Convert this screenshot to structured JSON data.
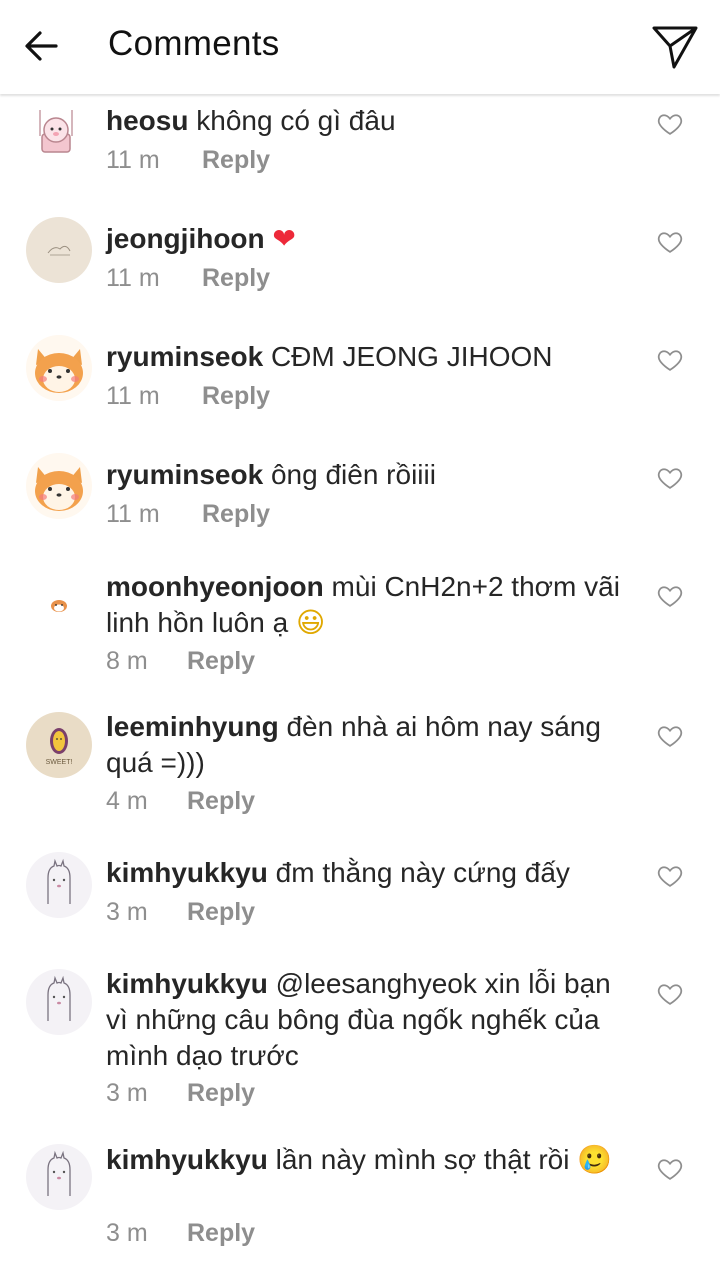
{
  "header": {
    "title": "Comments"
  },
  "comments": [
    {
      "username": "heosu",
      "text": "không có gì đâu",
      "emoji": "",
      "time": "11 m",
      "reply": "Reply"
    },
    {
      "username": "jeongjihoon",
      "text": "",
      "emoji": "❤",
      "time": "11 m",
      "reply": "Reply"
    },
    {
      "username": "ryuminseok",
      "text": "CĐM JEONG JIHOON",
      "emoji": "",
      "time": "11 m",
      "reply": "Reply"
    },
    {
      "username": "ryuminseok",
      "text": "ông điên rồiiii",
      "emoji": "",
      "time": "11 m",
      "reply": "Reply"
    },
    {
      "username": "moonhyeonjoon",
      "text": "mùi CnH2n+2 thơm vãi linh hồn luôn ạ",
      "emoji": "😃",
      "time": "8 m",
      "reply": "Reply"
    },
    {
      "username": "leeminhyung",
      "text": "đèn nhà ai hôm nay sáng quá =)))",
      "emoji": "",
      "time": "4 m",
      "reply": "Reply"
    },
    {
      "username": "kimhyukkyu",
      "text": "đm thằng này cứng đấy",
      "emoji": "",
      "time": "3 m",
      "reply": "Reply"
    },
    {
      "username": "kimhyukkyu",
      "text": "@leesanghyeok xin lỗi bạn vì những câu bông đùa ngốk nghếk của mình dạo trước",
      "emoji": "",
      "time": "3 m",
      "reply": "Reply"
    },
    {
      "username": "kimhyukkyu",
      "text": "lần này mình sợ thật rồi",
      "emoji": "🥲",
      "time": "3 m",
      "reply": "Reply"
    }
  ],
  "avatar_labels": {
    "sweet": "SWEET!"
  },
  "colors": {
    "text": "#262626",
    "muted": "#8e8e8e",
    "heart": "#ed2939"
  },
  "icons": {
    "back": "arrow-left-icon",
    "send": "paper-plane-icon",
    "like": "heart-outline-icon"
  }
}
